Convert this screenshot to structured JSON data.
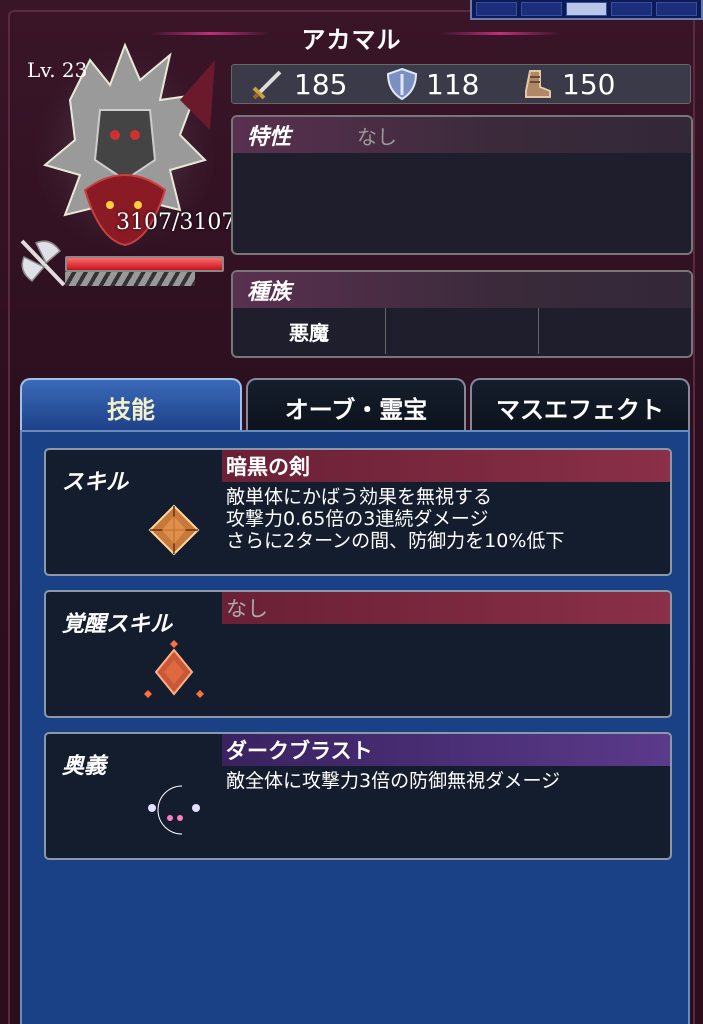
{
  "character": {
    "name": "アカマル",
    "level": "Lv. 23",
    "hp": "3107/3107",
    "hp_fraction": 1.0
  },
  "stats": [
    {
      "icon": "sword-icon",
      "value": "185"
    },
    {
      "icon": "shield-icon",
      "value": "118"
    },
    {
      "icon": "boot-icon",
      "value": "150"
    }
  ],
  "trait": {
    "title": "特性",
    "value": "なし"
  },
  "race": {
    "title": "種族",
    "cells": [
      "悪魔",
      "",
      ""
    ]
  },
  "tabs": [
    "技能",
    "オーブ・霊宝",
    "マスエフェクト"
  ],
  "active_tab": 0,
  "skills": [
    {
      "label": "スキル",
      "name": "暗黒の剣",
      "lines": [
        "敵単体にかばう効果を無視する",
        "攻撃力0.65倍の3連続ダメージ",
        "さらに2ターンの間、防御力を10%低下"
      ],
      "icon": "dark-crystal-icon"
    },
    {
      "label": "覚醒スキル",
      "name": "なし",
      "lines": [],
      "icon": "awakened-crystal-icon"
    },
    {
      "label": "奥義",
      "name": "ダークブラスト",
      "lines": [
        "敵全体に攻撃力3倍の防御無視ダメージ"
      ],
      "icon": "rainbow-moon-icon"
    }
  ]
}
